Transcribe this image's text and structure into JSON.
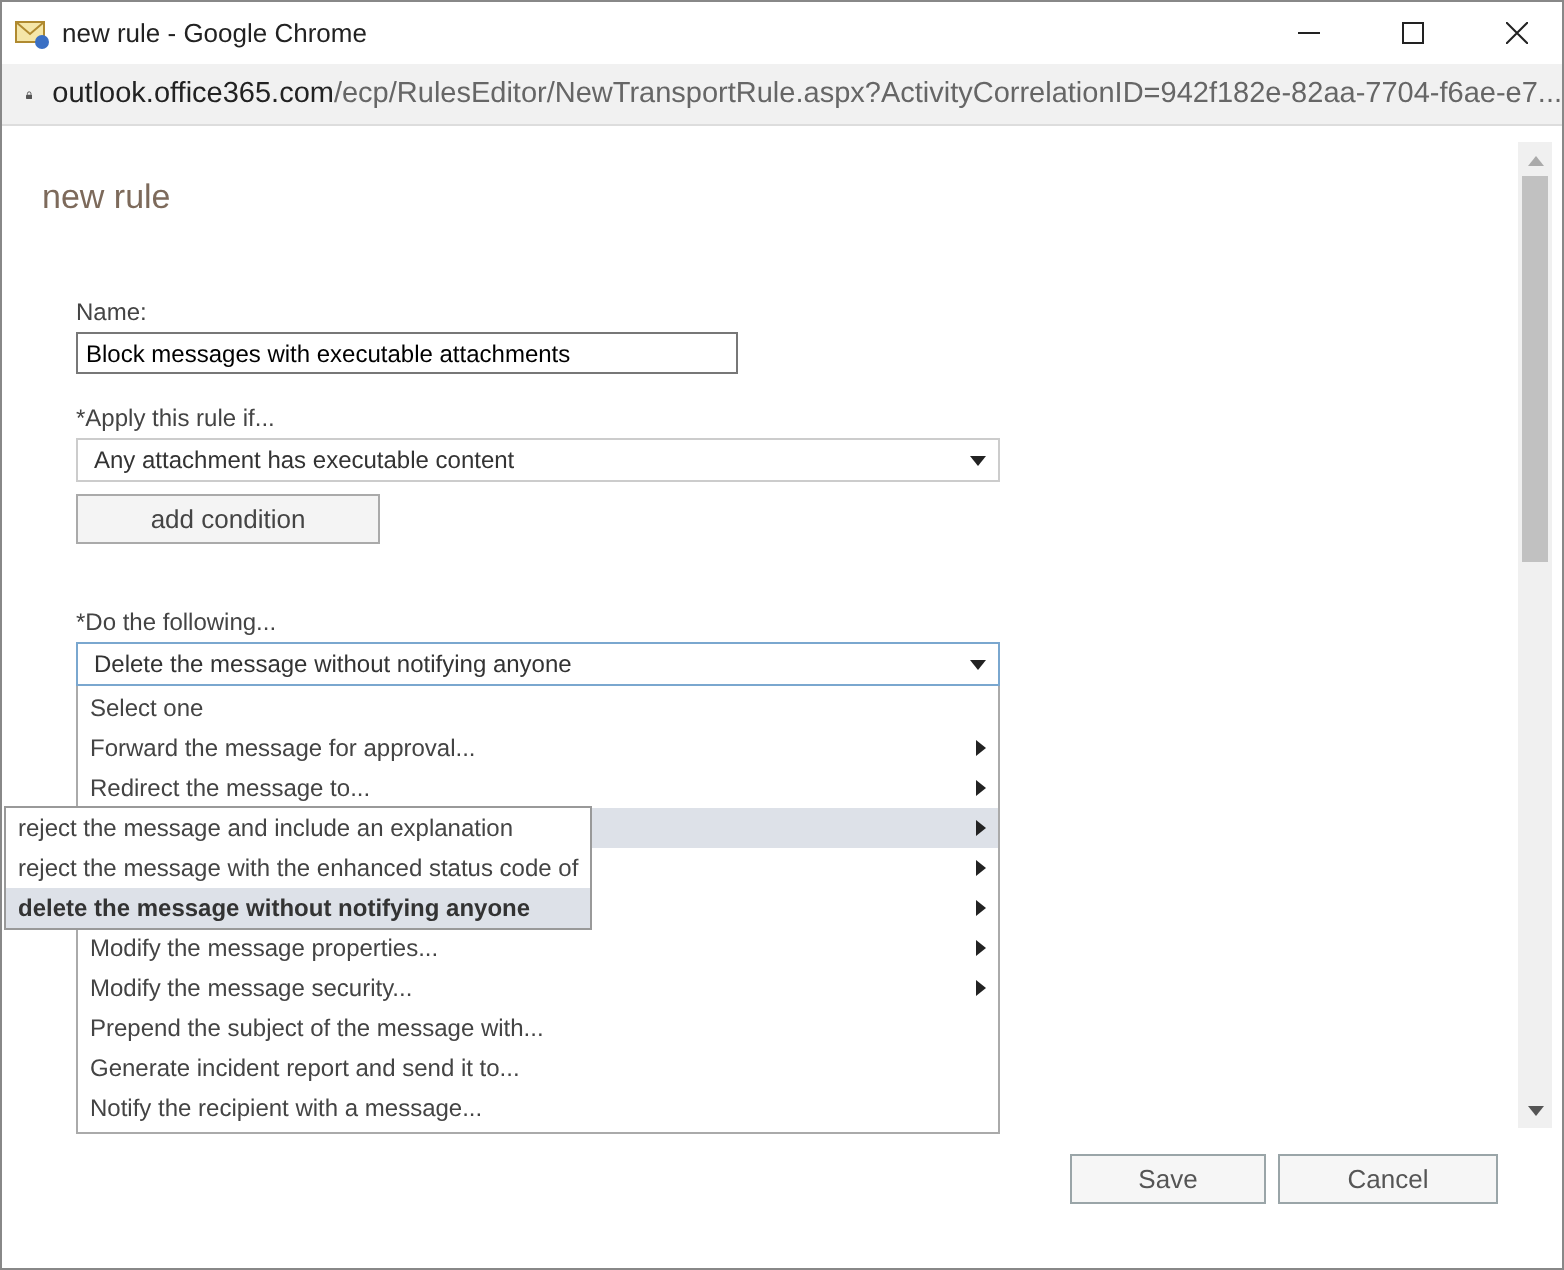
{
  "window": {
    "title": "new rule - Google Chrome",
    "url_host": "outlook.office365.com",
    "url_path": "/ecp/RulesEditor/NewTransportRule.aspx?ActivityCorrelationID=942f182e-82aa-7704-f6ae-e7..."
  },
  "heading": "new rule",
  "name_field": {
    "label": "Name:",
    "value": "Block messages with executable attachments"
  },
  "condition": {
    "label": "*Apply this rule if...",
    "value": "Any attachment has executable content",
    "button": "add condition"
  },
  "action": {
    "label": "*Do the following...",
    "value": "Delete the message without notifying anyone",
    "options": [
      {
        "label": "Select one",
        "has_submenu": false,
        "selected": false
      },
      {
        "label": "Forward the message for approval...",
        "has_submenu": true,
        "selected": false
      },
      {
        "label": "Redirect the message to...",
        "has_submenu": true,
        "selected": false
      },
      {
        "has_submenu": true,
        "selected": true
      },
      {
        "has_submenu": true,
        "selected": false
      },
      {
        "has_submenu": true,
        "selected": false
      },
      {
        "label": "Modify the message properties...",
        "has_submenu": true,
        "selected": false
      },
      {
        "label": "Modify the message security...",
        "has_submenu": true,
        "selected": false
      },
      {
        "label": "Prepend the subject of the message with...",
        "has_submenu": false,
        "selected": false
      },
      {
        "label": "Generate incident report and send it to...",
        "has_submenu": false,
        "selected": false
      },
      {
        "label": "Notify the recipient with a message...",
        "has_submenu": false,
        "selected": false
      }
    ],
    "submenu": [
      {
        "label": "reject the message and include an explanation",
        "selected": false
      },
      {
        "label": "reject the message with the enhanced status code of",
        "selected": false
      },
      {
        "label": "delete the message without notifying anyone",
        "selected": true
      }
    ]
  },
  "buttons": [
    "Save",
    "Cancel"
  ]
}
